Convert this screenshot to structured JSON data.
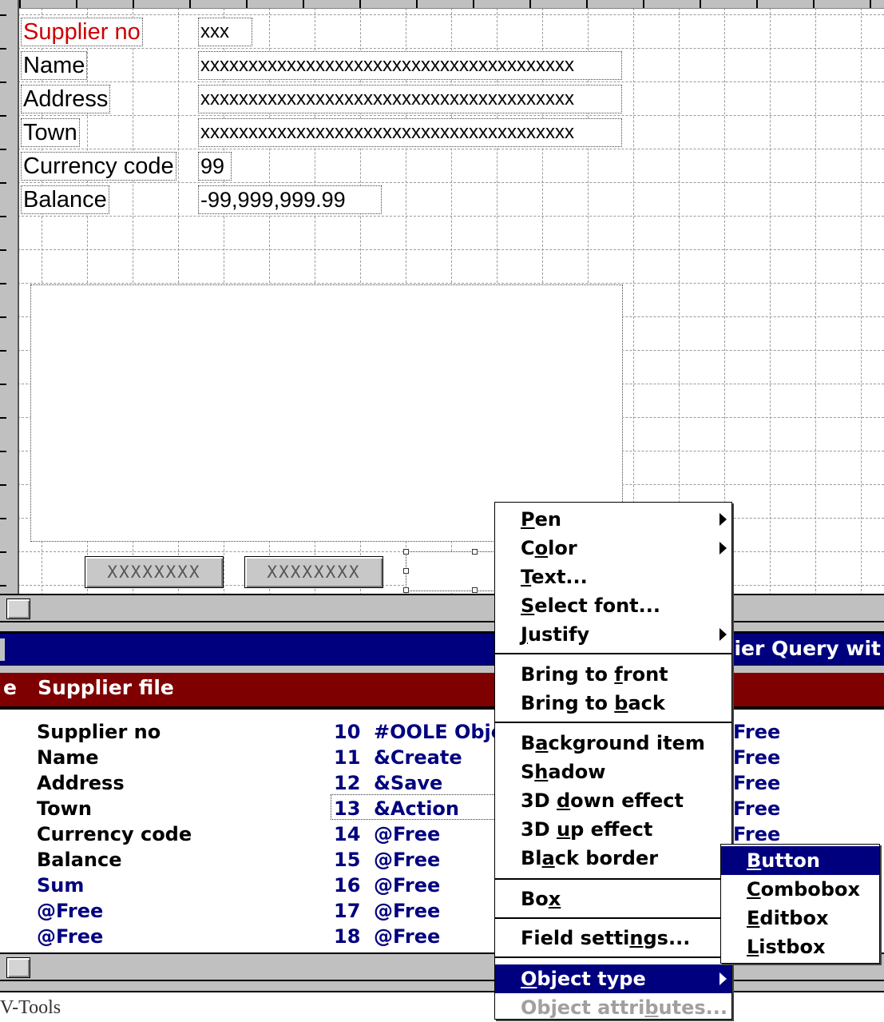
{
  "form": {
    "labels": {
      "supplier_no": "Supplier no",
      "name": "Name",
      "address": "Address",
      "town": "Town",
      "currency_code": "Currency code",
      "balance": "Balance"
    },
    "fields": {
      "supplier_no": "xxx",
      "name": "xxxxxxxxxxxxxxxxxxxxxxxxxxxxxxxxxxxxxxx",
      "address": "xxxxxxxxxxxxxxxxxxxxxxxxxxxxxxxxxxxxxxx",
      "town": "xxxxxxxxxxxxxxxxxxxxxxxxxxxxxxxxxxxxxxx",
      "currency_code": "99",
      "balance": "-99,999,999.99"
    },
    "buttons": [
      "XXXXXXXX",
      "XXXXXXXX"
    ],
    "label_color_selected": "#cc0000"
  },
  "windows": {
    "query_title": "pplier Query wit",
    "file_title": "e   Supplier file"
  },
  "field_list": {
    "col1": [
      "Supplier no",
      "Name",
      "Address",
      "Town",
      "Currency code",
      "Balance",
      "Sum",
      "@Free",
      "@Free"
    ],
    "col2_nums": [
      "10",
      "11",
      "12",
      "13",
      "14",
      "15",
      "16",
      "17",
      "18"
    ],
    "col2_names": [
      "#OOLE Obje",
      "&Create",
      "&Save",
      "&Action",
      "@Free",
      "@Free",
      "@Free",
      "@Free",
      "@Free"
    ],
    "col3": [
      "Free",
      "Free",
      "Free",
      "Free",
      "Free"
    ]
  },
  "status_bar": {
    "text": "V-Tools"
  },
  "context_menu": {
    "pen": [
      "",
      "P",
      "en"
    ],
    "color": [
      "C",
      "o",
      "lor"
    ],
    "text": [
      "",
      "T",
      "ext..."
    ],
    "select_font": [
      "",
      "S",
      "elect font..."
    ],
    "justify": [
      "",
      "J",
      "ustify"
    ],
    "bring_front": [
      "Bring to ",
      "f",
      "ront"
    ],
    "bring_back": [
      "Bring to ",
      "b",
      "ack"
    ],
    "background_item": [
      "B",
      "a",
      "ckground item"
    ],
    "shadow": [
      "S",
      "h",
      "adow"
    ],
    "down3d": [
      "3D ",
      "d",
      "own effect"
    ],
    "up3d": [
      "3D ",
      "u",
      "p effect"
    ],
    "black_border": [
      "Bl",
      "a",
      "ck border"
    ],
    "box": [
      "Bo",
      "x",
      ""
    ],
    "field_settings": [
      "Field setti",
      "n",
      "gs..."
    ],
    "object_type": [
      "",
      "O",
      "bject type"
    ],
    "object_attributes": [
      "Object attri",
      "b",
      "utes..."
    ]
  },
  "submenu": {
    "button": [
      "",
      "B",
      "utton"
    ],
    "combobox": [
      "",
      "C",
      "ombobox"
    ],
    "editbox": [
      "",
      "E",
      "ditbox"
    ],
    "listbox": [
      "",
      "L",
      "istbox"
    ]
  }
}
